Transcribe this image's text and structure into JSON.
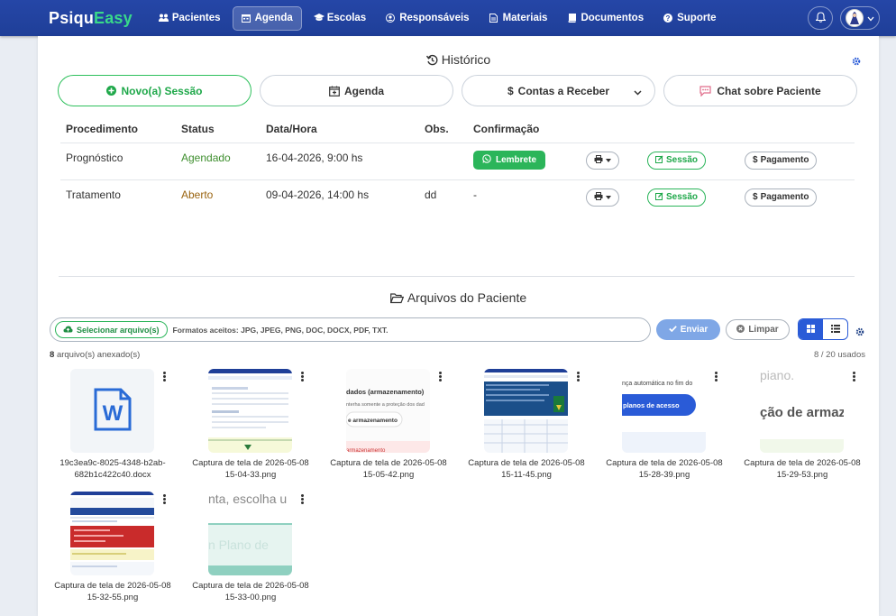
{
  "navbar": {
    "brand_part1": "Psiqu",
    "brand_part2": "Easy",
    "items": [
      {
        "label": "Pacientes",
        "icon": "users-icon"
      },
      {
        "label": "Agenda",
        "icon": "calendar-icon",
        "active": true
      },
      {
        "label": "Escolas",
        "icon": "graduation-cap-icon"
      },
      {
        "label": "Responsáveis",
        "icon": "user-circle-icon"
      },
      {
        "label": "Materiais",
        "icon": "file-icon"
      },
      {
        "label": "Documentos",
        "icon": "book-icon"
      },
      {
        "label": "Suporte",
        "icon": "question-circle-icon"
      }
    ],
    "colors": {
      "background": "#2346a6",
      "brand_accent": "#39d98a"
    }
  },
  "historico": {
    "title": "Histórico",
    "buttons": {
      "novo_sessao": "Novo(a) Sessão",
      "agenda": "Agenda",
      "contas": "Contas a Receber",
      "chat": "Chat sobre Paciente"
    },
    "columns": [
      "Procedimento",
      "Status",
      "Data/Hora",
      "Obs.",
      "Confirmação"
    ],
    "rows": [
      {
        "procedimento": "Prognóstico",
        "status": "Agendado",
        "data": "16-04-2026, 9:00 hs",
        "obs": "",
        "confirmacao": "Lembrete",
        "sessao": "Sessão",
        "pagamento": "Pagamento"
      },
      {
        "procedimento": "Tratamento",
        "status": "Aberto",
        "data": "09-04-2026, 14:00 hs",
        "obs": "dd",
        "confirmacao": "-",
        "sessao": "Sessão",
        "pagamento": "Pagamento"
      }
    ]
  },
  "arquivos": {
    "title": "Arquivos do Paciente",
    "select_label": "Selecionar arquivo(s)",
    "formats": "Formatos aceitos: JPG, JPEG, PNG, DOC, DOCX, PDF, TXT.",
    "enviar": "Enviar",
    "limpar": "Limpar",
    "count_number": "8",
    "count_text": "arquivo(s) anexado(s)",
    "usage": "8 / 20 usados",
    "files": [
      {
        "name": "19c3ea9c-8025-4348-b2ab-682b1c422c40.docx",
        "kind": "word"
      },
      {
        "name": "Captura de tela de 2026-05-08 15-04-33.png",
        "kind": "image"
      },
      {
        "name": "Captura de tela de 2026-05-08 15-05-42.png",
        "kind": "image"
      },
      {
        "name": "Captura de tela de 2026-05-08 15-11-45.png",
        "kind": "image"
      },
      {
        "name": "Captura de tela de 2026-05-08 15-28-39.png",
        "kind": "image"
      },
      {
        "name": "Captura de tela de 2026-05-08 15-29-53.png",
        "kind": "image"
      },
      {
        "name": "Captura de tela de 2026-05-08 15-32-55.png",
        "kind": "image"
      },
      {
        "name": "Captura de tela de 2026-05-08 15-33-00.png",
        "kind": "image"
      }
    ],
    "thumb_texts": {
      "t3a": "dados (armazenamento)",
      "t3b": "nterha somente a proteção dos dad",
      "t3c": "e armazenamento",
      "t3d": "armazenamento",
      "t5a": "nça automática no fim do",
      "t5b": "planos de acesso",
      "t6a": "piano.",
      "t6b": "ção de armaz",
      "t8a": "nta, escolha u",
      "t8b": "n Plano de"
    }
  }
}
